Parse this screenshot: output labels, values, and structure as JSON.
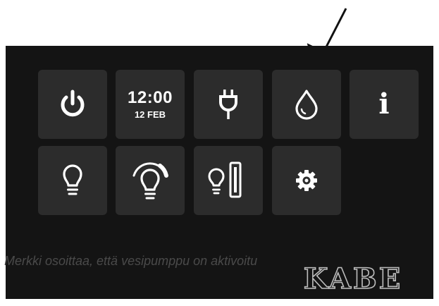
{
  "clock": {
    "time": "12:00",
    "date": "12 FEB"
  },
  "info_label": "i",
  "caption": "Merkki osoittaa, että vesipumppu on aktivoitu",
  "brand": "KABE",
  "icons": [
    "power-icon",
    "clock-tile",
    "plug-icon",
    "water-drop-icon",
    "info-icon",
    "bulb-icon",
    "dimmer-bulb-icon",
    "bulb-slider-icon",
    "gear-icon",
    "pointer-arrow"
  ]
}
